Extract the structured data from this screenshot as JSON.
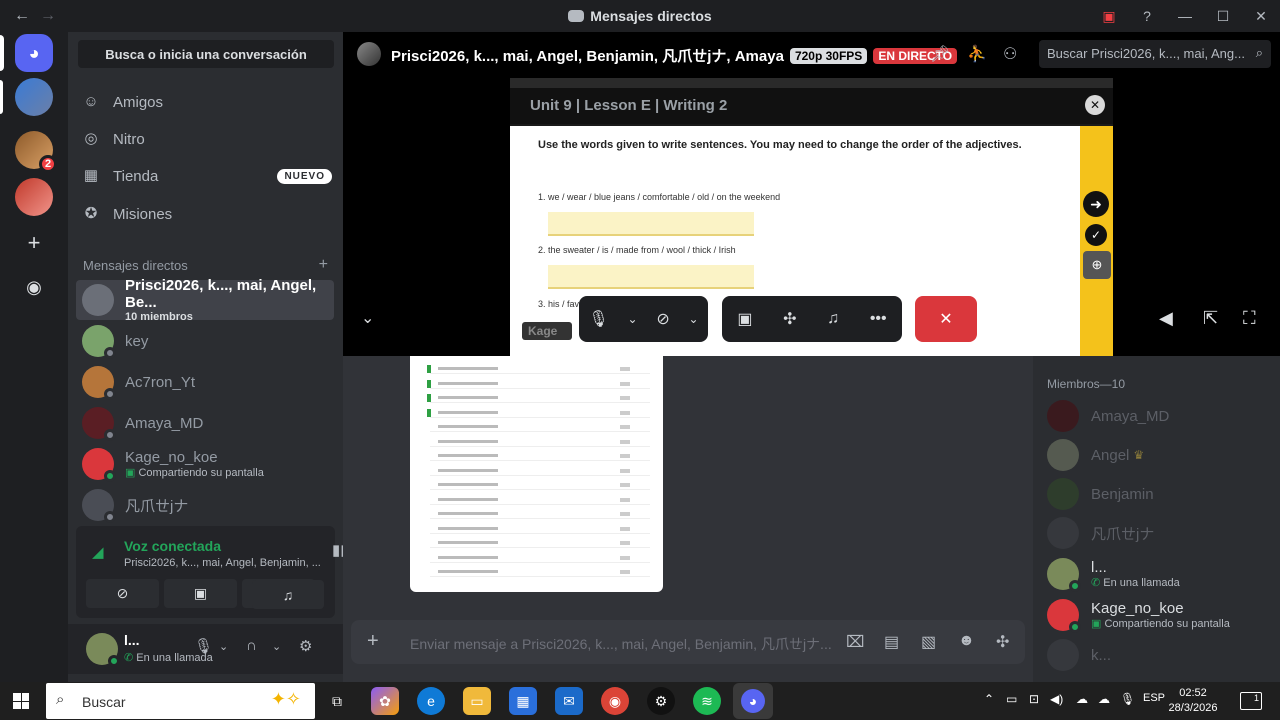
{
  "window": {
    "title": "Mensajes directos",
    "back_icon": "←",
    "forward_icon": "→",
    "controls": [
      "—",
      "☐",
      "✕"
    ]
  },
  "guilds": {
    "home_label": "Discord",
    "badge": "2",
    "add_icon": "+",
    "explore_icon": "◉"
  },
  "sidebar": {
    "search": "Busca o inicia una conversación",
    "nav": [
      {
        "label": "Amigos",
        "icon": "friends-icon"
      },
      {
        "label": "Nitro",
        "icon": "nitro-icon"
      },
      {
        "label": "Tienda",
        "icon": "store-icon",
        "badge": "NUEVO"
      },
      {
        "label": "Misiones",
        "icon": "quests-icon"
      }
    ],
    "dm_header": "Mensajes directos",
    "dm_add": "+",
    "dms": [
      {
        "name": "Prisci2026, k..., mai, Angel, Be...",
        "sub": "10 miembros",
        "active": true,
        "color": "#6b6f78"
      },
      {
        "name": "key",
        "sub": "",
        "status": "off",
        "color": "#7aa36b"
      },
      {
        "name": "Ac7ron_Yt",
        "sub": "",
        "status": "off",
        "color": "#b5753a"
      },
      {
        "name": "Amaya_MD",
        "sub": "",
        "status": "off",
        "color": "#5a1e24"
      },
      {
        "name": "Kage_no_koe",
        "sub": "Compartiendo su pantalla",
        "status": "on",
        "color": "#da373c"
      },
      {
        "name": "凡爪ㄝjナ",
        "sub": "",
        "status": "off",
        "color": "#4a4d55"
      }
    ]
  },
  "voice": {
    "title": "Voz conectada",
    "channel": "Prisci2026, k..., mai, Angel, Benjamin, ..."
  },
  "user": {
    "name": "l...",
    "status": "En una llamada"
  },
  "topbar": {
    "title": "Prisci2026, k..., mai, Angel, Benjamin, 凡爪ㄝjナ, Amaya",
    "quality": "720p 30FPS",
    "live": "EN DIRECTO",
    "search_placeholder": "Buscar Prisci2026, k..., mai, Ang..."
  },
  "stream": {
    "doc_title": "Unit 9 | Lesson E | Writing 2",
    "instruction": "Use the words given to write sentences. You may need to change the order of the adjectives.",
    "q1": "1.   we / wear / blue jeans / comfortable / old / on the weekend",
    "q2": "2.   the sweater / is / made from / wool / thick / Irish",
    "q3": "3.   his / favo",
    "streamer_label": "Kage"
  },
  "chat": {
    "placeholder": "Enviar mensaje a Prisci2026, k..., mai, Angel, Benjamin, 凡爪ㄝjナ..."
  },
  "members": {
    "header": "Miembros—10",
    "list": [
      {
        "name": "Amaya_MD",
        "sub": "",
        "online": false,
        "color": "#5a1e24"
      },
      {
        "name": "Angel",
        "sub": "",
        "online": false,
        "color": "#8a8f7a",
        "crown": "♛"
      },
      {
        "name": "Benjamin",
        "sub": "",
        "online": false,
        "color": "#3b5a3a"
      },
      {
        "name": "凡爪ㄝjナ",
        "sub": "",
        "online": false,
        "color": "#4a4d55"
      },
      {
        "name": "l...",
        "sub": "En una llamada",
        "online": true,
        "color": "#7a8a5a"
      },
      {
        "name": "Kage_no_koe",
        "sub": "Compartiendo su pantalla",
        "online": true,
        "color": "#da373c"
      },
      {
        "name": "k...",
        "sub": "",
        "online": false,
        "color": "#4a4d55"
      }
    ]
  },
  "taskbar": {
    "search": "Buscar",
    "lang": "ESP",
    "time": "02:52",
    "date": "28/3/2026",
    "notif": "1"
  }
}
